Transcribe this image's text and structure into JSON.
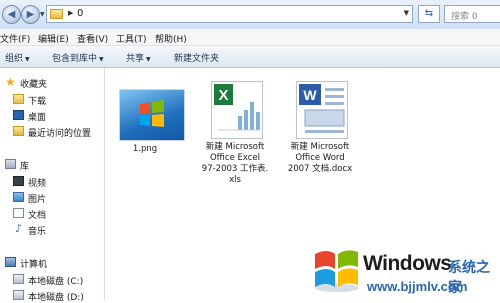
{
  "address": {
    "path_segment": "0",
    "search_placeholder": "搜索 0"
  },
  "menu": [
    "文件(F)",
    "编辑(E)",
    "查看(V)",
    "工具(T)",
    "帮助(H)"
  ],
  "commands": {
    "organize": "组织",
    "include": "包含到库中",
    "share": "共享",
    "new_folder": "新建文件夹"
  },
  "nav": {
    "favorites": {
      "header": "收藏夹",
      "items": [
        "下载",
        "桌面",
        "最近访问的位置"
      ]
    },
    "libraries": {
      "header": "库",
      "items": [
        "视频",
        "图片",
        "文档",
        "音乐"
      ]
    },
    "computer": {
      "header": "计算机",
      "items": [
        "本地磁盘 (C:)",
        "本地磁盘 (D:)"
      ]
    }
  },
  "files": [
    {
      "name": "1.png",
      "type": "png"
    },
    {
      "name": "新建 Microsoft Office Excel 97-2003 工作表.xls",
      "name_lines": [
        "新建 Microsoft",
        "Office Excel",
        "97-2003 工作表.",
        "xls"
      ],
      "type": "xls"
    },
    {
      "name": "新建 Microsoft Office Word 2007 文档.docx",
      "name_lines": [
        "新建 Microsoft",
        "Office Word",
        "2007 文档.docx"
      ],
      "type": "docx"
    }
  ],
  "watermark": {
    "brand": "Windows",
    "cn": "系统之家",
    "url": "www.bjjmlv.com"
  },
  "colors": {
    "accent": "#2a67b0",
    "titlebar": "#cfdff2",
    "excel_green": "#1e7a3c",
    "word_blue": "#2a5caa"
  }
}
